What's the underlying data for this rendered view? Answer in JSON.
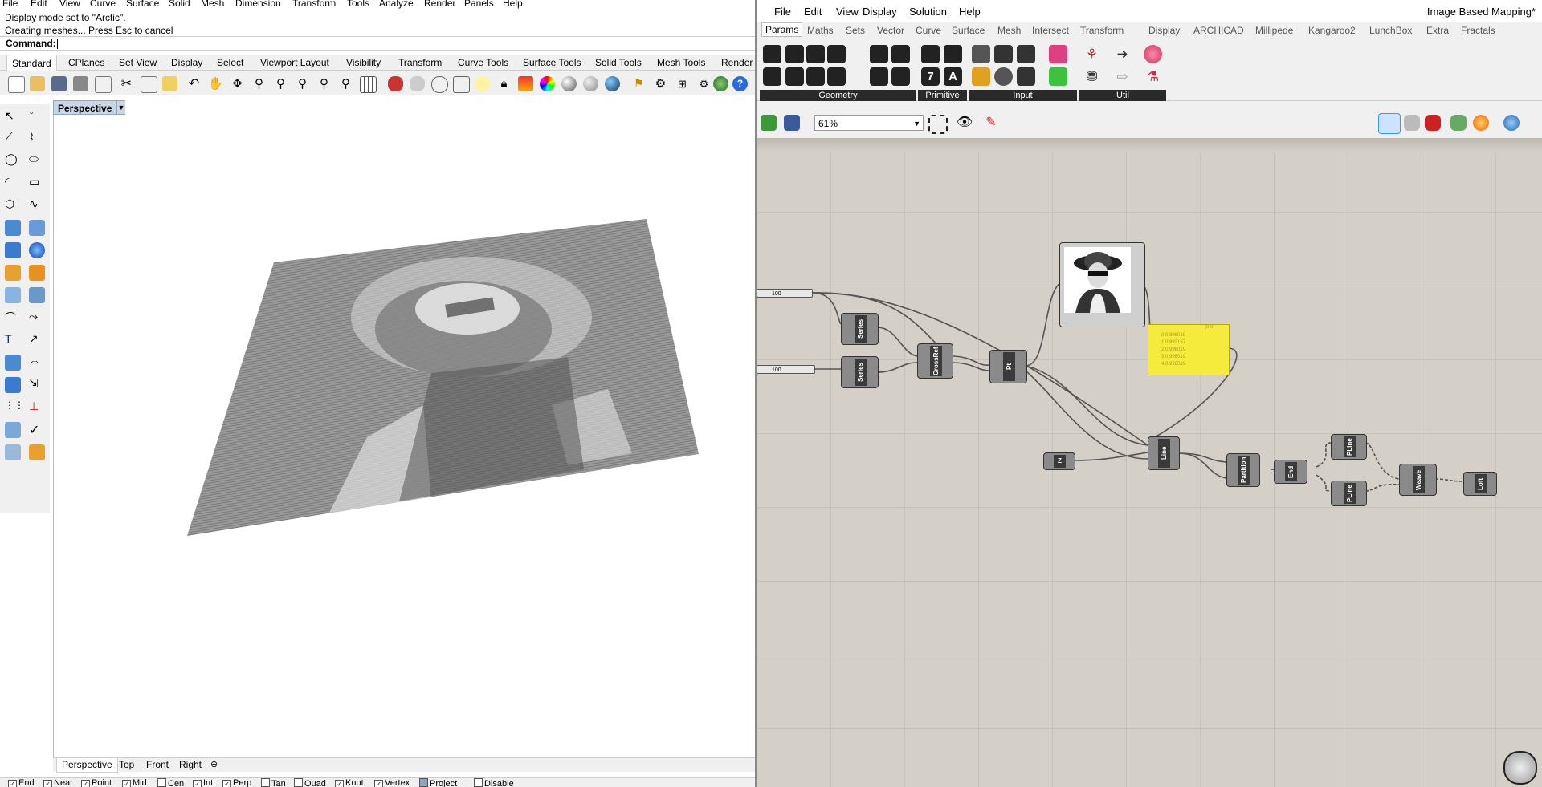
{
  "rhino": {
    "menu": [
      "File",
      "Edit",
      "View",
      "Curve",
      "Surface",
      "Solid",
      "Mesh",
      "Dimension",
      "Transform",
      "Tools",
      "Analyze",
      "Render",
      "Panels",
      "Help"
    ],
    "command_history": [
      "Display mode set to \"Arctic\".",
      "Creating meshes... Press Esc to cancel"
    ],
    "command_label": "Command:",
    "tabs": [
      "Standard",
      "CPlanes",
      "Set View",
      "Display",
      "Select",
      "Viewport Layout",
      "Visibility",
      "Transform",
      "Curve Tools",
      "Surface Tools",
      "Solid Tools",
      "Mesh Tools",
      "Render"
    ],
    "active_tab": "Standard",
    "viewport_label": "Perspective",
    "viewport_tabs": [
      "Perspective",
      "Top",
      "Front",
      "Right"
    ],
    "osnaps": [
      {
        "label": "End",
        "checked": true
      },
      {
        "label": "Near",
        "checked": true
      },
      {
        "label": "Point",
        "checked": true
      },
      {
        "label": "Mid",
        "checked": true
      },
      {
        "label": "Cen",
        "checked": false
      },
      {
        "label": "Int",
        "checked": true
      },
      {
        "label": "Perp",
        "checked": true
      },
      {
        "label": "Tan",
        "checked": false
      },
      {
        "label": "Quad",
        "checked": false
      },
      {
        "label": "Knot",
        "checked": true
      },
      {
        "label": "Vertex",
        "checked": true
      },
      {
        "label": "Project",
        "checked": false
      },
      {
        "label": "Disable",
        "checked": false
      }
    ]
  },
  "grasshopper": {
    "menu": [
      "File",
      "Edit",
      "View",
      "Display",
      "Solution",
      "Help"
    ],
    "title": "Image Based Mapping*",
    "tabs": [
      "Params",
      "Maths",
      "Sets",
      "Vector",
      "Curve",
      "Surface",
      "Mesh",
      "Intersect",
      "Transform",
      "Display",
      "ARCHICAD",
      "Millipede",
      "Kangaroo2",
      "LunchBox",
      "Extra",
      "Fractals"
    ],
    "active_tab": "Params",
    "ribbon_groups": [
      "Geometry",
      "Primitive",
      "Input",
      "Util"
    ],
    "zoom": "61%",
    "components": {
      "slider1": "100",
      "slider2": "100",
      "series1": "Series",
      "series2": "Series",
      "crossref": "CrossRef",
      "pt": "Pt",
      "z": "Z",
      "line": "Line",
      "partition": "Partition",
      "end": "End",
      "pline1": "PLine",
      "pline2": "PLine",
      "weave": "Weave",
      "loft": "Loft"
    },
    "panel_header": "{0;0}",
    "panel_rows": [
      "0 0.996019",
      "1 0.992157",
      "2 0.996019",
      "3 0.996019",
      "4 0.996019"
    ]
  },
  "colors": {
    "panel_yellow": "#f5eb3c",
    "canvas": "#d4d0c8",
    "viewport_label": "#c9d6e6"
  }
}
